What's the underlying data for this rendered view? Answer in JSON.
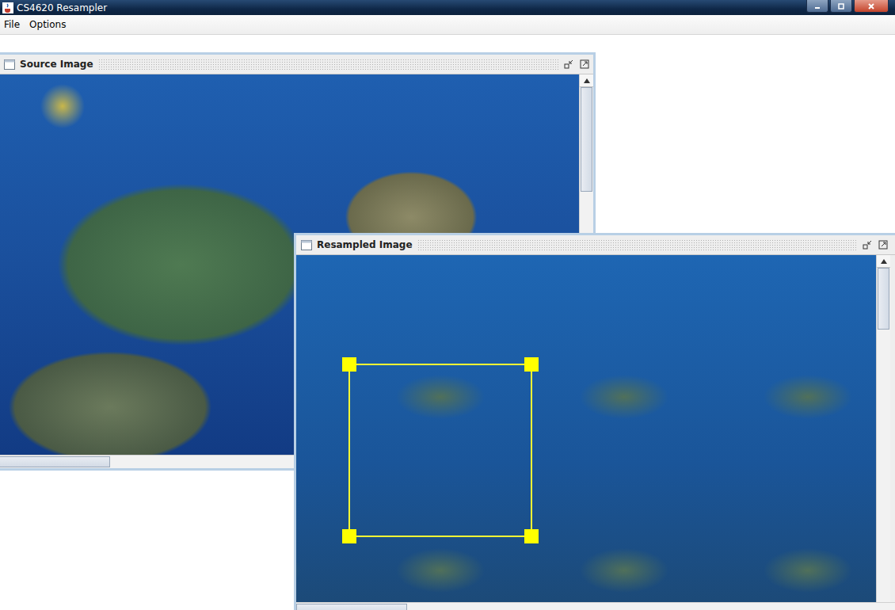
{
  "window": {
    "title": "CS4620 Resampler"
  },
  "menu": [
    {
      "label": "File"
    },
    {
      "label": "Options"
    }
  ],
  "frames": [
    {
      "title": "Source Image",
      "scroll": {
        "v": 0,
        "h": 0
      },
      "selection": false
    },
    {
      "title": "Resampled Image",
      "scroll": {
        "v": 0,
        "h": 0
      },
      "selection": true
    }
  ]
}
